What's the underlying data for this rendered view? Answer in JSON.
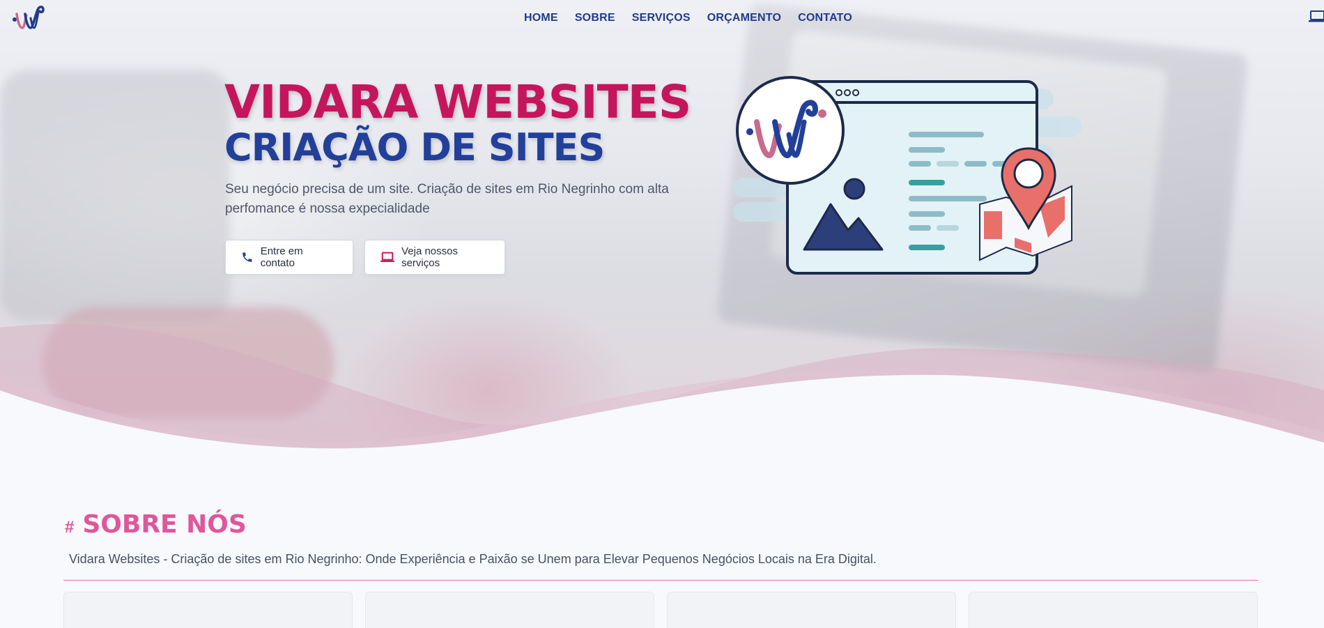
{
  "nav": {
    "logo_icon": "vidara-logo-icon",
    "items": [
      {
        "label": "HOME"
      },
      {
        "label": "SOBRE"
      },
      {
        "label": "SERVIÇOS"
      },
      {
        "label": "ORÇAMENTO"
      },
      {
        "label": "CONTATO"
      }
    ],
    "corner_icon": "laptop-icon"
  },
  "hero": {
    "title": "VIDARA WEBSITES",
    "subtitle_heading": "CRIAÇÃO DE SITES",
    "description": "Seu negócio precisa de um site. Criação de sites em Rio Negrinho com alta perfomance é nossa expecialidade",
    "buttons": {
      "contact": {
        "label": "Entre em contato",
        "icon": "phone-icon"
      },
      "services": {
        "label": "Veja nossos serviços",
        "icon": "laptop-icon"
      }
    },
    "illustration_icon": "website-location-illustration"
  },
  "sobre": {
    "hash": "#",
    "title": "SOBRE NÓS",
    "description": "Vidara Websites - Criação de sites em Rio Negrinho: Onde Experiência e Paixão se Unem para Elevar Pequenos Negócios Locais na Era Digital."
  },
  "colors": {
    "brand_pink": "#c5165d",
    "brand_blue": "#22409a",
    "accent_pink": "#e0569a",
    "nav_blue": "#203a8c"
  }
}
